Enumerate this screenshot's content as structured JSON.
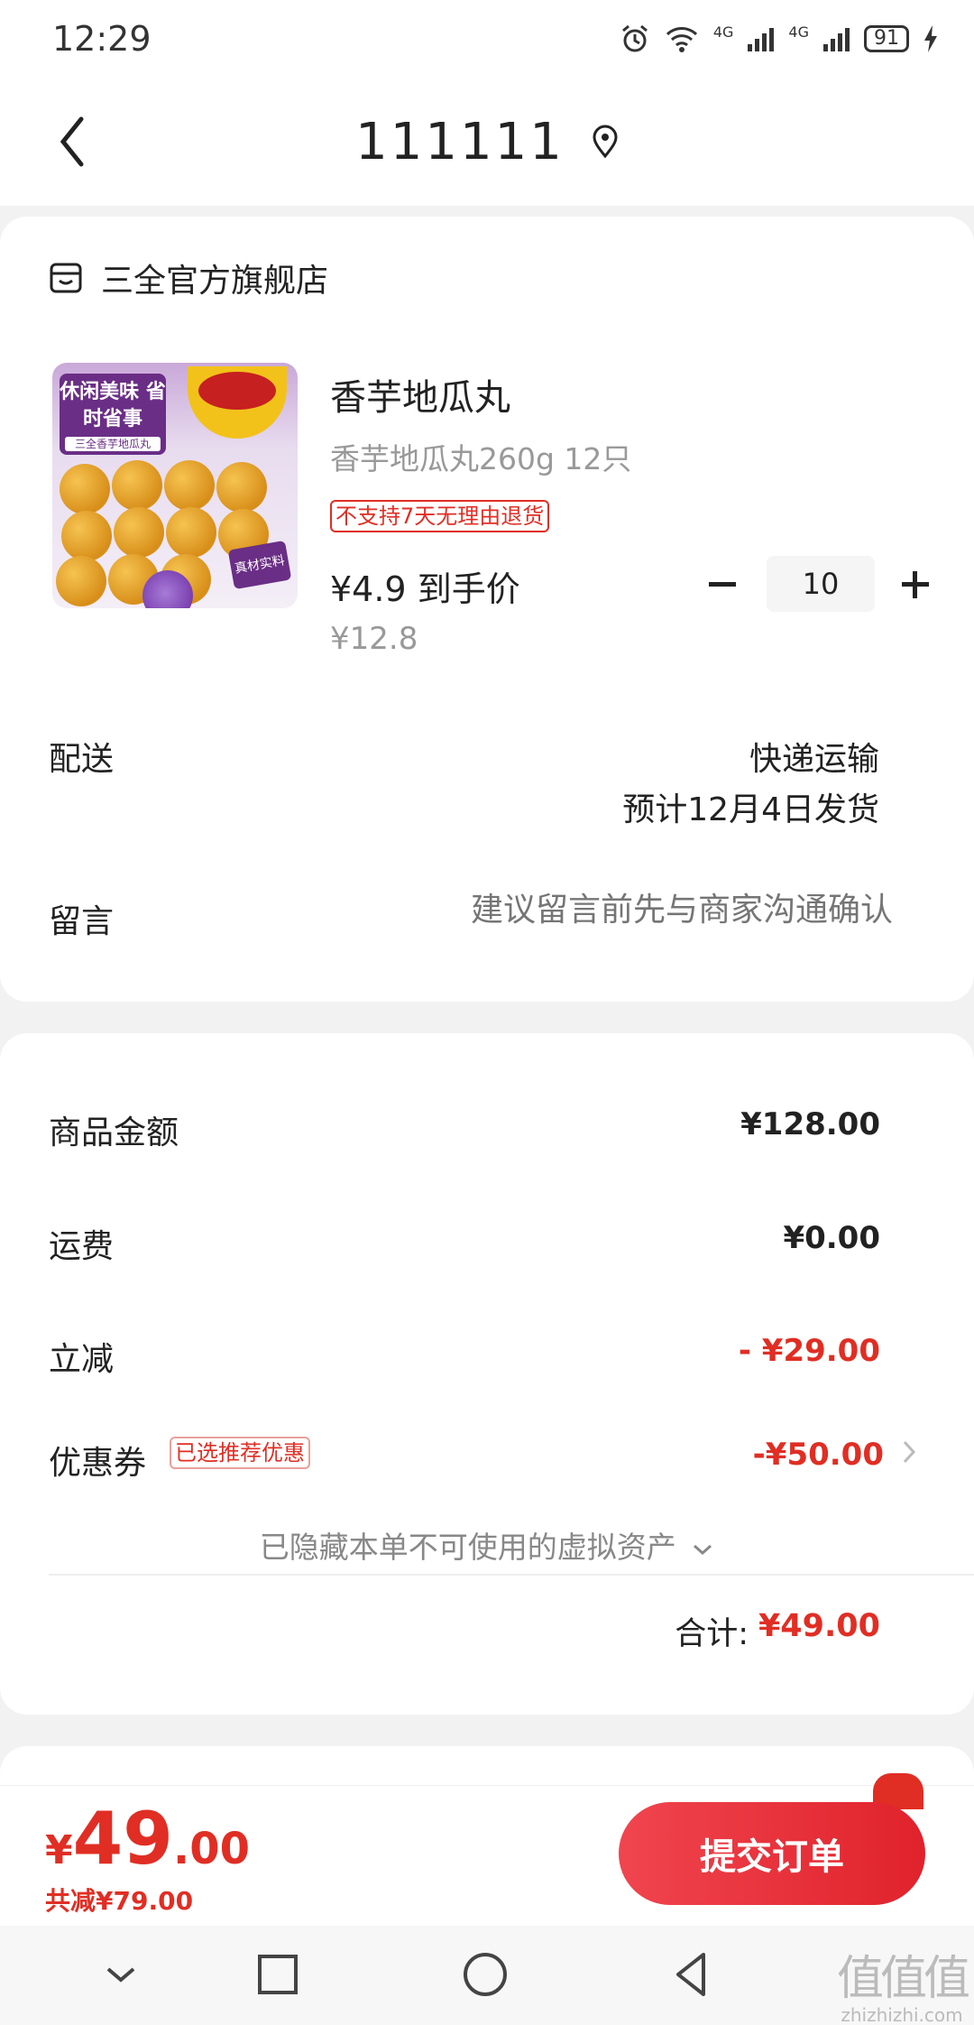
{
  "status_bar": {
    "time": "12:29",
    "network_a": "4G",
    "network_b": "4G",
    "battery": "91"
  },
  "nav": {
    "title": "111111"
  },
  "store": {
    "name": "三全官方旗舰店"
  },
  "product": {
    "image_banner": "休闲美味 省时省事",
    "image_sub": "三全香芋地瓜丸",
    "image_tag": "真材实料",
    "title": "香芋地瓜丸",
    "spec": "香芋地瓜丸260g 12只",
    "badge": "不支持7天无理由退货",
    "price": "¥4.9 到手价",
    "original_price": "¥12.8",
    "quantity": "10"
  },
  "shipping": {
    "label": "配送",
    "method": "快递运输",
    "eta": "预计12月4日发货"
  },
  "message": {
    "label": "留言",
    "placeholder": "建议留言前先与商家沟通确认"
  },
  "summary": {
    "goods_label": "商品金额",
    "goods_value": "¥128.00",
    "freight_label": "运费",
    "freight_value": "¥0.00",
    "discount_label": "立减",
    "discount_value": "- ¥29.00",
    "coupon_label": "优惠券",
    "coupon_tag": "已选推荐优惠",
    "coupon_value": "-¥50.00",
    "hidden_note": "已隐藏本单不可使用的虚拟资产",
    "total_label": "合计:",
    "total_value": "¥49.00"
  },
  "bottom": {
    "currency": "¥",
    "price_int": "49",
    "price_dec": ".00",
    "saved": "共减¥79.00",
    "submit_label": "提交订单"
  },
  "watermark": {
    "logo": "值值值",
    "site": "zhizhizhi.com"
  },
  "colors": {
    "accent": "#e02e24",
    "background": "#f2f2f2"
  }
}
